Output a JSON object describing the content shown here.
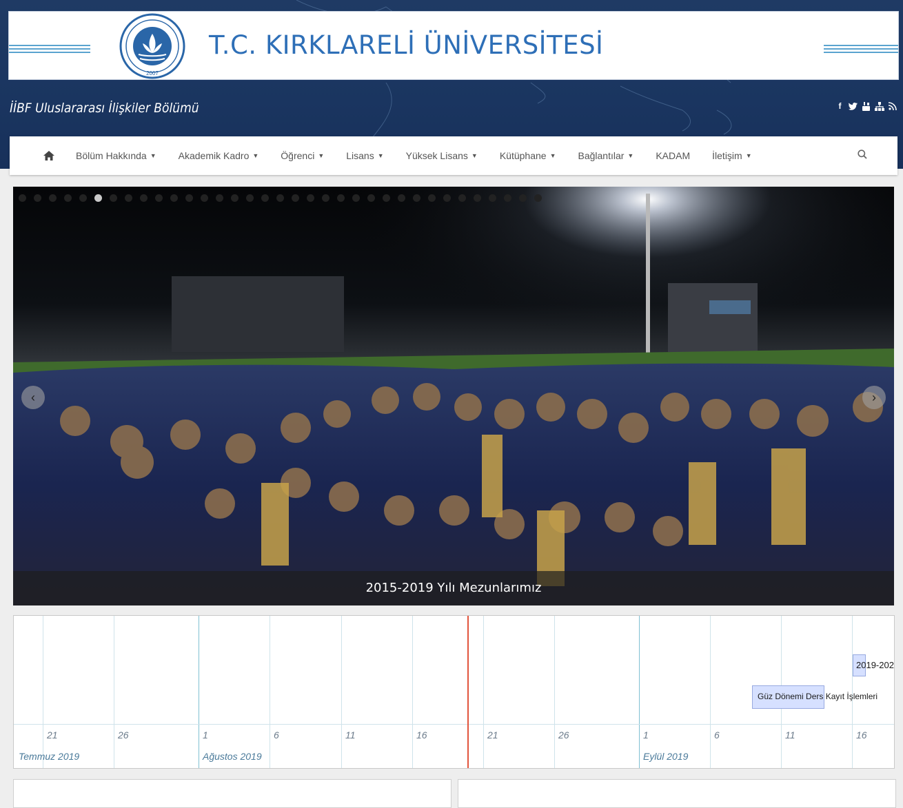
{
  "header": {
    "site_title": "T.C. KIRKLARELİ ÜNİVERSİTESİ",
    "department": "İİBF Uluslararası İlişkiler Bölümü",
    "logo_text": "KIRKLARELİ ÜNİVERSİTESİ 2007",
    "social_icons": [
      "facebook-icon",
      "twitter-icon",
      "youtube-icon",
      "sitemap-icon",
      "rss-icon"
    ],
    "colors": {
      "band": "#1f3a64",
      "title": "#2e6fb7"
    }
  },
  "nav": {
    "items": [
      {
        "label": "Bölüm Hakkında",
        "dropdown": true
      },
      {
        "label": "Akademik Kadro",
        "dropdown": true
      },
      {
        "label": "Öğrenci",
        "dropdown": true
      },
      {
        "label": "Lisans",
        "dropdown": true
      },
      {
        "label": "Yüksek Lisans",
        "dropdown": true
      },
      {
        "label": "Kütüphane",
        "dropdown": true
      },
      {
        "label": "Bağlantılar",
        "dropdown": true
      },
      {
        "label": "KADAM",
        "dropdown": false
      },
      {
        "label": "İletişim",
        "dropdown": true
      }
    ],
    "home_icon": "home-icon",
    "search_icon": "search-icon"
  },
  "slider": {
    "caption": "2015-2019 Yılı Mezunlarımız",
    "dot_count": 35,
    "active_dot": 5
  },
  "timeline": {
    "days": [
      "21",
      "26",
      "1",
      "6",
      "11",
      "16",
      "21",
      "26",
      "1",
      "6",
      "11",
      "16"
    ],
    "months": [
      "Temmuz 2019",
      "Ağustos 2019",
      "Eylül 2019"
    ],
    "events": [
      "2019-202",
      "Güz Dönemi Ders Kayıt İşlemleri"
    ],
    "today_color": "#e2543c"
  }
}
